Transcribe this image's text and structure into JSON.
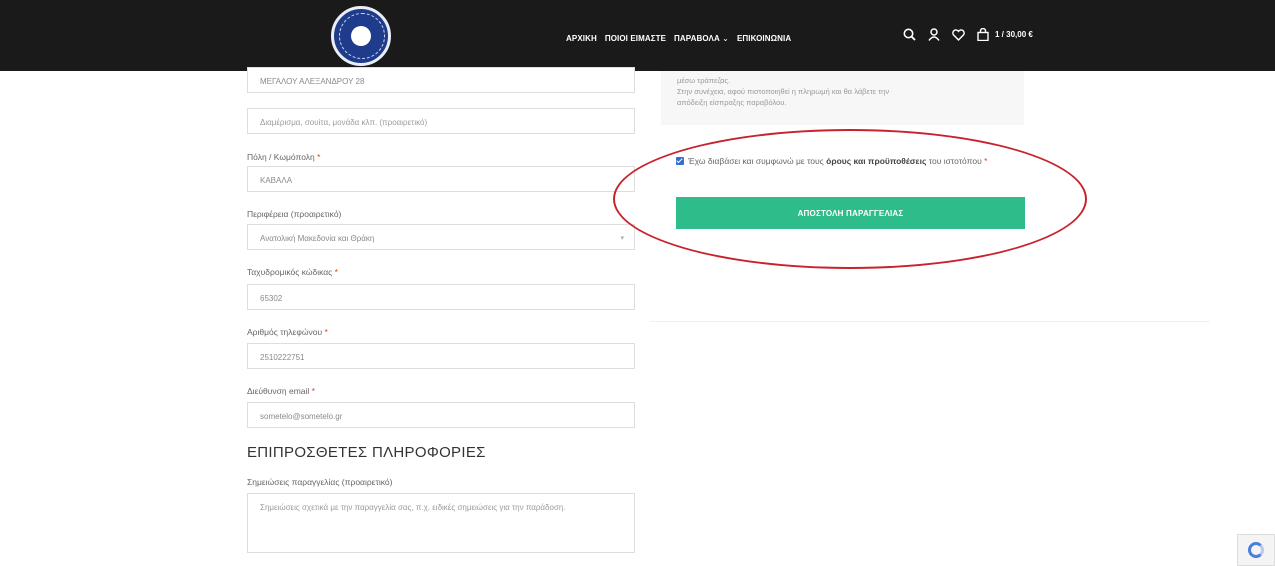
{
  "header": {
    "nav": [
      "ΑΡΧΙΚΗ",
      "ΠΟΙΟΙ ΕΙΜΑΣΤΕ",
      "ΠΑΡΑΒΟΛΑ",
      "ΕΠΙΚΟΙΝΩΝΙΑ"
    ],
    "nav_caret": "⌄",
    "cart": "1 / 30,00 €",
    "icons": [
      "search-icon",
      "user-icon",
      "heart-icon",
      "bag-icon",
      "logo"
    ]
  },
  "billing": {
    "street_value": "ΜΕΓΑΛΟΥ ΑΛΕΞΑΝΔΡΟΥ 28",
    "street2_placeholder": "Διαμέρισμα, σουίτα, μονάδα κλπ. (προαιρετικό)",
    "city_label": "Πόλη / Κωμόπολη",
    "city_value": "ΚΑΒΑΛΑ",
    "region_label": "Περιφέρεια (προαιρετικό)",
    "region_value": "Ανατολική Μακεδονία και Θράκη",
    "postcode_label": "Ταχυδρομικός κώδικας",
    "postcode_value": "65302",
    "phone_label": "Αριθμός τηλεφώνου",
    "phone_value": "2510222751",
    "email_label": "Διεύθυνση email",
    "email_value": "sometelo@sometelo.gr",
    "required_mark": "*"
  },
  "additional": {
    "title": "ΕΠΙΠΡΟΣΘΕΤΕΣ ΠΛΗΡΟΦΟΡΙΕΣ",
    "notes_label": "Σημειώσεις παραγγελίας (προαιρετικό)",
    "notes_placeholder": "Σημειώσεις σχετικά με την παραγγελία σας, π.χ. ειδικές σημειώσεις για την παράδοση."
  },
  "payment": {
    "line1": "μέσω τράπεζας.",
    "line2": "Στην συνέχεια, αφού πιστοποιηθεί η πληρωμή και θα λάβετε την",
    "line3": "απόδειξη είσπραξης παραβόλου."
  },
  "terms": {
    "prefix": "Έχω διαβάσει και συμφωνώ με τους",
    "link": "όρους και προϋποθέσεις",
    "suffix": "του ιστοτόπου",
    "required_mark": "*"
  },
  "order_button": "ΑΠΟΣΤΟΛΗ ΠΑΡΑΓΓΕΛΙΑΣ",
  "colors": {
    "header_bg": "#1a1a1a",
    "button_green": "#2ebc8a",
    "annotation_red": "#c8232c"
  }
}
